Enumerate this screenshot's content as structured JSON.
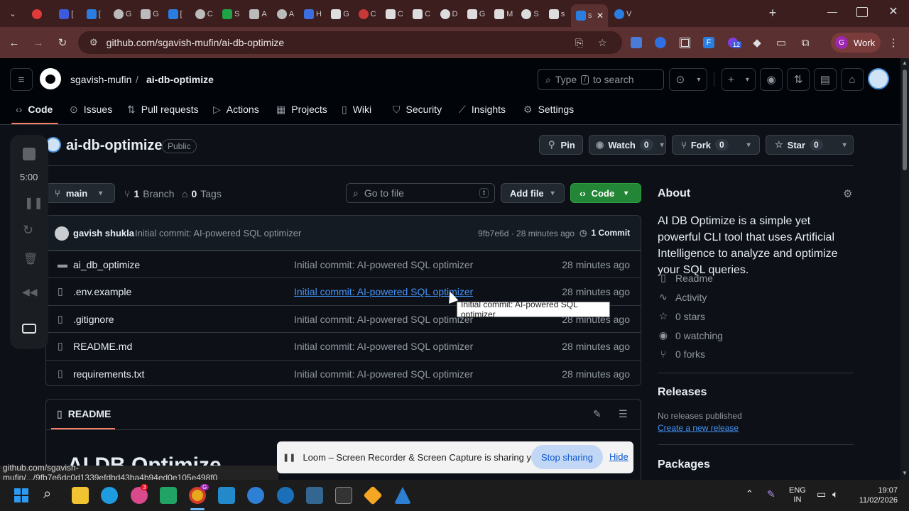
{
  "browser": {
    "address": "github.com/sgavish-mufin/ai-db-optimize",
    "profile_label": "Work",
    "profile_initial": "G",
    "extension_badge": "12",
    "active_tab_label": "s",
    "tab_letters": [
      "",
      "",
      "[",
      "[",
      "G",
      "G",
      "[",
      "C",
      "S",
      "A",
      "A",
      "H",
      "G",
      "C",
      "C",
      "C",
      "D",
      "G",
      "M",
      "S",
      "s",
      "V",
      "V"
    ]
  },
  "header": {
    "owner": "sgavish-mufin",
    "separator": "/",
    "repo": "ai-db-optimize",
    "search_placeholder": "Type / to search",
    "search_slash": "/",
    "search_prefix": "Type",
    "search_suffix": "to search"
  },
  "nav": {
    "code": "Code",
    "issues": "Issues",
    "pull_requests": "Pull requests",
    "actions": "Actions",
    "projects": "Projects",
    "wiki": "Wiki",
    "security": "Security",
    "insights": "Insights",
    "settings": "Settings"
  },
  "loom_panel": {
    "timer": "5:00"
  },
  "repo": {
    "name": "ai-db-optimize",
    "visibility": "Public",
    "pin": "Pin",
    "watch": "Watch",
    "watch_count": "0",
    "fork": "Fork",
    "fork_count": "0",
    "star": "Star",
    "star_count": "0"
  },
  "branchbar": {
    "branch": "main",
    "branches_count": "1",
    "branches_label": "Branch",
    "tags_count": "0",
    "tags_label": "Tags",
    "goto_placeholder": "Go to file",
    "goto_key": "t",
    "add_file": "Add file",
    "code_button": "Code"
  },
  "commit": {
    "author": "gavish shukla",
    "message": "Initial commit: AI-powered SQL optimizer",
    "hash_time": "9fb7e6d · 28 minutes ago",
    "commits_label": "1 Commit"
  },
  "files": [
    {
      "name": "ai_db_optimize",
      "type": "folder",
      "message": "Initial commit: AI-powered SQL optimizer",
      "time": "28 minutes ago"
    },
    {
      "name": ".env.example",
      "type": "file",
      "message": "Initial commit: AI-powered SQL optimizer",
      "time": "28 minutes ago"
    },
    {
      "name": ".gitignore",
      "type": "file",
      "message": "Initial commit: AI-powered SQL optimizer",
      "time": "28 minutes ago"
    },
    {
      "name": "README.md",
      "type": "file",
      "message": "Initial commit: AI-powered SQL optimizer",
      "time": "28 minutes ago"
    },
    {
      "name": "requirements.txt",
      "type": "file",
      "message": "Initial commit: AI-powered SQL optimizer",
      "time": "28 minutes ago"
    }
  ],
  "readme": {
    "tab": "README",
    "heading": "AI DB Optimize"
  },
  "about": {
    "title": "About",
    "description": "AI DB Optimize is a simple yet powerful CLI tool that uses Artificial Intelligence to analyze and optimize your SQL queries.",
    "readme": "Readme",
    "activity": "Activity",
    "stars": "0 stars",
    "watching": "0 watching",
    "forks": "0 forks",
    "releases_title": "Releases",
    "no_releases": "No releases published",
    "create_release": "Create a new release",
    "packages_title": "Packages"
  },
  "tooltip": "Initial commit: AI-powered SQL optimizer",
  "status_url": "github.com/sgavish-mufin/.../9fb7e6dc0d1339efdbd43ba4b94ed0e105e498f0",
  "loom_bar": {
    "message": "Loom – Screen Recorder & Screen Capture is sharing your screen.",
    "stop": "Stop sharing",
    "hide": "Hide"
  },
  "taskbar": {
    "lang": "ENG",
    "region": "IN",
    "time": "19:07",
    "date": "11/02/2026",
    "chrome_badge": "G",
    "app_badge": "3"
  },
  "colors": {
    "accent_green": "#238636",
    "link_blue": "#4493f8",
    "tab_underline": "#f78166"
  }
}
